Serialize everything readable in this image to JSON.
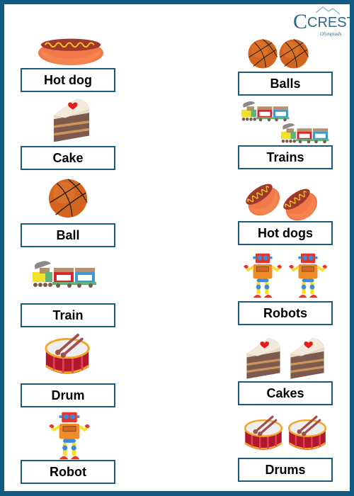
{
  "brand": {
    "name": "CREST",
    "sub": "Olympiads",
    "color": "#2a6b8c"
  },
  "frame_color": "#125b80",
  "left_column": [
    {
      "label": "Hot dog",
      "image": "hotdog-icon",
      "count": 1
    },
    {
      "label": "Cake",
      "image": "cake-icon",
      "count": 1
    },
    {
      "label": "Ball",
      "image": "basketball-icon",
      "count": 1
    },
    {
      "label": "Train",
      "image": "train-icon",
      "count": 1
    },
    {
      "label": "Drum",
      "image": "drum-icon",
      "count": 1
    },
    {
      "label": "Robot",
      "image": "robot-icon",
      "count": 1
    }
  ],
  "right_column": [
    {
      "label": "Balls",
      "image": "basketball-icon",
      "count": 2
    },
    {
      "label": "Trains",
      "image": "train-icon",
      "count": 2
    },
    {
      "label": "Hot dogs",
      "image": "hotdog-icon",
      "count": 2
    },
    {
      "label": "Robots",
      "image": "robot-icon",
      "count": 2
    },
    {
      "label": "Cakes",
      "image": "cake-icon",
      "count": 2
    },
    {
      "label": "Drums",
      "image": "drum-icon",
      "count": 2
    }
  ]
}
